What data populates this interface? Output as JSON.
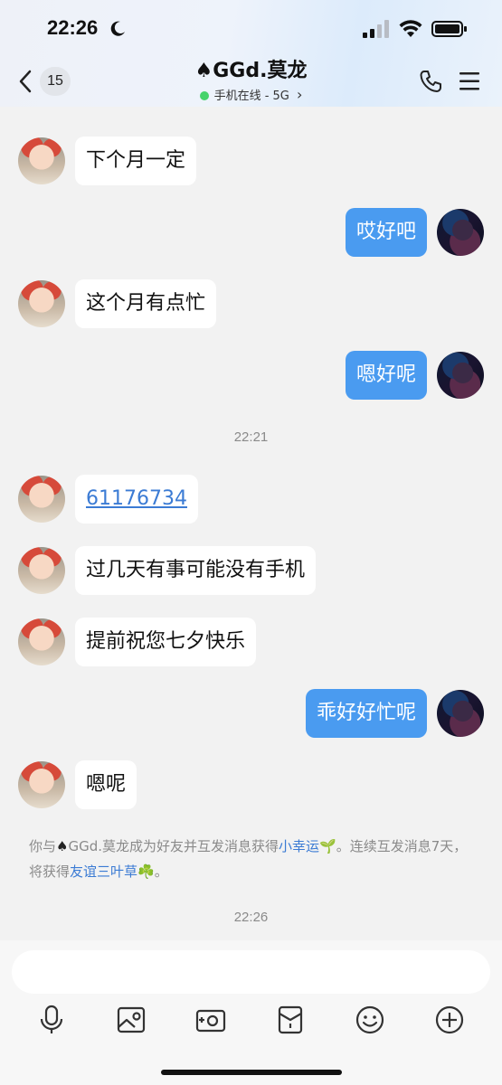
{
  "status_bar": {
    "time": "22:26"
  },
  "header": {
    "unread_count": "15",
    "title": "♠GGd.莫龙",
    "subtitle": "手机在线 - 5G",
    "subtitle_arrow": "›"
  },
  "messages": [
    {
      "side": "in",
      "text": "下个月一定"
    },
    {
      "side": "out",
      "text": "哎好吧"
    },
    {
      "side": "in",
      "text": "这个月有点忙"
    },
    {
      "side": "out",
      "text": "嗯好呢"
    },
    {
      "side": "time",
      "text": "22:21"
    },
    {
      "side": "in",
      "text": "61176734"
    },
    {
      "side": "in",
      "text": "过几天有事可能没有手机"
    },
    {
      "side": "in",
      "text": "提前祝您七夕快乐"
    },
    {
      "side": "out",
      "text": "乖好好忙呢"
    },
    {
      "side": "in",
      "text": "嗯呢"
    }
  ],
  "system_notice": {
    "part1": "你与",
    "spade": "♠",
    "part2": "GGd.莫龙成为好友并互发消息获得",
    "link1": "小幸运",
    "emoji1": "🌱",
    "part3": "。连续互发消息7天，将获得",
    "link2": "友谊三叶草",
    "emoji2": "☘️",
    "part4": "。"
  },
  "last_time": "22:26",
  "input": {
    "placeholder": ""
  },
  "toolbar": [
    "microphone-icon",
    "image-icon",
    "camera-icon",
    "red-packet-icon",
    "emoji-icon",
    "plus-icon"
  ]
}
